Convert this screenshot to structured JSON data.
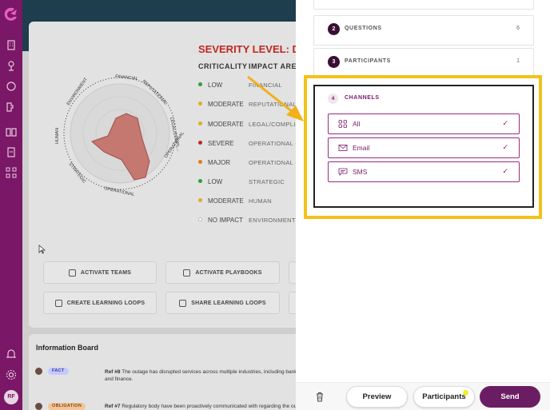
{
  "nav": {
    "icons": [
      "logo-icon",
      "building-icon",
      "map-pin-icon",
      "chat-icon",
      "puzzle-icon",
      "book-icon",
      "clipboard-icon",
      "network-icon",
      "bell-icon",
      "gear-icon"
    ],
    "avatar_initials": "RF"
  },
  "severity": {
    "title": "SEVERITY LEVEL: DECL",
    "col_criticality": "CRITICALITY",
    "col_area": "IMPACT AREA",
    "rows": [
      {
        "level": "LOW",
        "area": "FINANCIAL",
        "color": "#2e9d3a"
      },
      {
        "level": "MODERATE",
        "area": "REPUTATIONAL",
        "color": "#d8b11f"
      },
      {
        "level": "MODERATE",
        "area": "LEGAL/COMPLIA",
        "color": "#d8b11f"
      },
      {
        "level": "SEVERE",
        "area": "OPERATIONAL - P",
        "color": "#c0271f"
      },
      {
        "level": "MAJOR",
        "area": "OPERATIONAL - P",
        "color": "#e07b1a"
      },
      {
        "level": "LOW",
        "area": "STRATEGIC",
        "color": "#2e9d3a"
      },
      {
        "level": "MODERATE",
        "area": "HUMAN",
        "color": "#d8b11f"
      },
      {
        "level": "NO IMPACT",
        "area": "ENVIRONMENT",
        "color": "#ffffff"
      }
    ],
    "radar_labels": {
      "financial": "FINANCIAL",
      "reputational": "REPUTATIONAL",
      "legal": "LEGAL/COMPL...",
      "operational1": "OPERATIONAL",
      "operational2": "OPERATIONAL",
      "strategic": "STRATEGIC",
      "human": "HUMAN",
      "environment": "ENVIRONMENT"
    }
  },
  "actions": {
    "activate_teams": "ACTIVATE TEAMS",
    "activate_playbooks": "ACTIVATE PLAYBOOKS",
    "create_learning_loops": "CREATE LEARNING LOOPS",
    "share_learning_loops": "SHARE LEARNING LOOPS"
  },
  "info_board": {
    "title": "Information Board",
    "items": [
      {
        "badge": "FACT",
        "badge_color": "#c5c9ff",
        "ref": "Ref #8",
        "text": "The outage has disrupted services across multiple industries, including bank",
        "text2": "and finance."
      },
      {
        "badge": "OBLIGATION",
        "badge_color": "#f2c59a",
        "ref": "Ref #7",
        "text": "Regulatory body have been proactively communicated with regarding the ou",
        "text2": ""
      }
    ]
  },
  "steps": [
    {
      "num": "2",
      "label": "QUESTIONS",
      "count": "6"
    },
    {
      "num": "3",
      "label": "PARTICIPANTS",
      "count": "1"
    }
  ],
  "channels": {
    "num": "4",
    "label": "CHANNELS",
    "options": [
      {
        "label": "All",
        "icon": "grid-icon",
        "checked": true
      },
      {
        "label": "Email",
        "icon": "mail-icon",
        "checked": true
      },
      {
        "label": "SMS",
        "icon": "sms-icon",
        "checked": true
      }
    ],
    "check_glyph": "✓"
  },
  "footer": {
    "preview": "Preview",
    "participants": "Participants",
    "send": "Send"
  },
  "colors": {
    "brand": "#7a1766",
    "highlight": "#f2c21a",
    "arrow": "#f2b01a"
  }
}
